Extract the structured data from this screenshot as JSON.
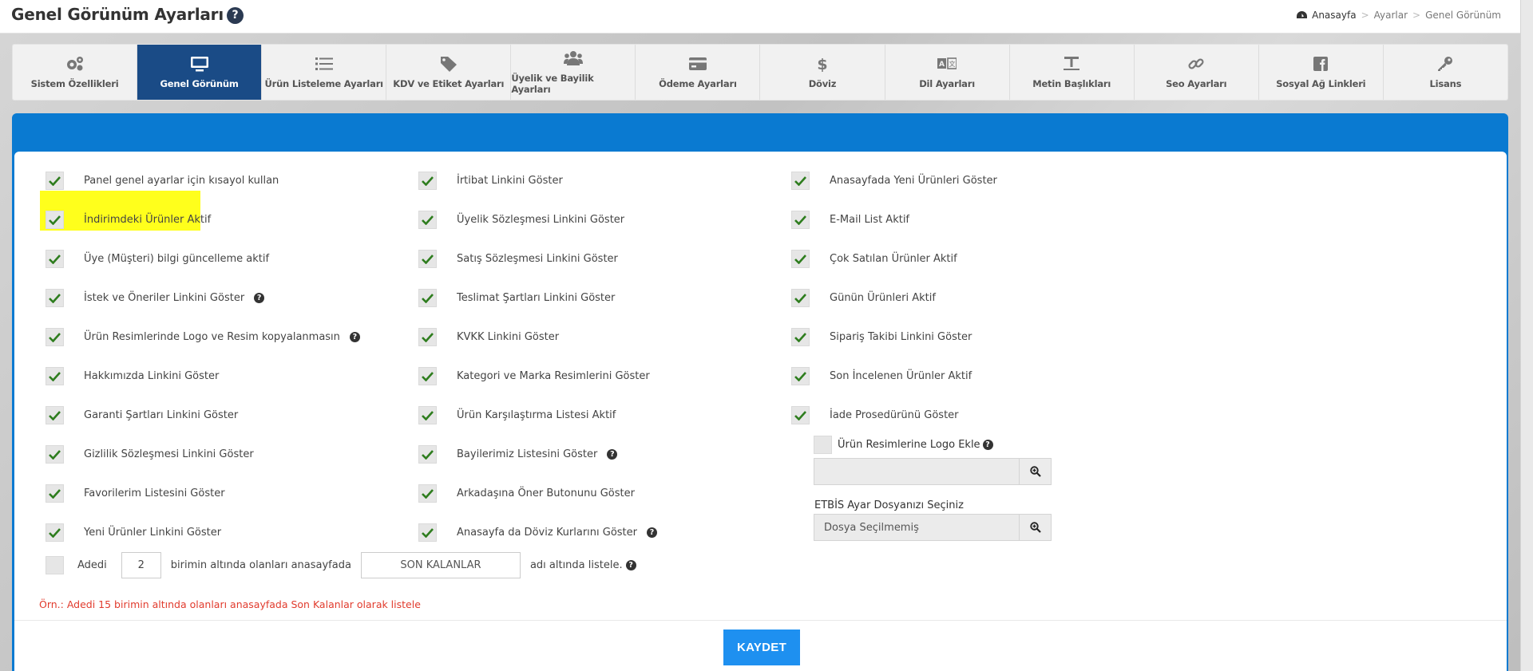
{
  "header": {
    "title": "Genel Görünüm Ayarları",
    "help_glyph": "?",
    "breadcrumb": [
      "Anasayfa",
      "Ayarlar",
      "Genel Görünüm"
    ],
    "breadcrumb_sep": ">"
  },
  "tabs": [
    {
      "label": "Sistem Özellikleri",
      "icon": "gears-icon",
      "active": false
    },
    {
      "label": "Genel Görünüm",
      "icon": "monitor-icon",
      "active": true
    },
    {
      "label": "Ürün Listeleme Ayarları",
      "icon": "list-icon",
      "active": false
    },
    {
      "label": "KDV ve Etiket Ayarları",
      "icon": "tags-icon",
      "active": false
    },
    {
      "label": "Üyelik ve Bayilik Ayarları",
      "icon": "users-icon",
      "active": false
    },
    {
      "label": "Ödeme Ayarları",
      "icon": "credit-card-icon",
      "active": false
    },
    {
      "label": "Döviz",
      "icon": "dollar-icon",
      "active": false
    },
    {
      "label": "Dil Ayarları",
      "icon": "language-icon",
      "active": false
    },
    {
      "label": "Metin Başlıkları",
      "icon": "text-heading-icon",
      "active": false
    },
    {
      "label": "Seo Ayarları",
      "icon": "link-icon",
      "active": false
    },
    {
      "label": "Sosyal Ağ Linkleri",
      "icon": "facebook-icon",
      "active": false
    },
    {
      "label": "Lisans",
      "icon": "key-icon",
      "active": false
    }
  ],
  "columns": {
    "col1": [
      {
        "label": "Panel genel ayarlar için kısayol kullan",
        "checked": true
      },
      {
        "label": "İndirimdeki Ürünler Aktif",
        "checked": true,
        "highlighted": true
      },
      {
        "label": "Üye (Müşteri) bilgi güncelleme aktif",
        "checked": true
      },
      {
        "label": "İstek ve Öneriler Linkini Göster",
        "checked": true,
        "help": true
      },
      {
        "label": "Ürün Resimlerinde Logo ve Resim kopyalanmasın",
        "checked": true,
        "help": true
      },
      {
        "label": "Hakkımızda Linkini Göster",
        "checked": true
      },
      {
        "label": "Garanti Şartları Linkini Göster",
        "checked": true
      },
      {
        "label": "Gizlilik Sözleşmesi Linkini Göster",
        "checked": true
      },
      {
        "label": "Favorilerim Listesini Göster",
        "checked": true
      },
      {
        "label": "Yeni Ürünler Linkini Göster",
        "checked": true
      }
    ],
    "col2": [
      {
        "label": "İrtibat Linkini Göster",
        "checked": true
      },
      {
        "label": "Üyelik Sözleşmesi Linkini Göster",
        "checked": true
      },
      {
        "label": "Satış Sözleşmesi Linkini Göster",
        "checked": true
      },
      {
        "label": "Teslimat Şartları Linkini Göster",
        "checked": true
      },
      {
        "label": "KVKK Linkini Göster",
        "checked": true
      },
      {
        "label": "Kategori ve Marka Resimlerini Göster",
        "checked": true
      },
      {
        "label": "Ürün Karşılaştırma Listesi Aktif",
        "checked": true
      },
      {
        "label": "Bayilerimiz Listesini Göster",
        "checked": true,
        "help": true
      },
      {
        "label": "Arkadaşına Öner Butonunu Göster",
        "checked": true
      },
      {
        "label": "Anasayfa da Döviz Kurlarını Göster",
        "checked": true,
        "help": true
      }
    ],
    "col3": [
      {
        "label": "Anasayfada Yeni Ürünleri Göster",
        "checked": true
      },
      {
        "label": "E-Mail List Aktif",
        "checked": true
      },
      {
        "label": "Çok Satılan Ürünler Aktif",
        "checked": true
      },
      {
        "label": "Günün Ürünleri Aktif",
        "checked": true
      },
      {
        "label": "Sipariş Takibi Linkini Göster",
        "checked": true
      },
      {
        "label": "Son İncelenen Ürünler Aktif",
        "checked": true
      },
      {
        "label": "İade Prosedürünü Göster",
        "checked": true
      }
    ]
  },
  "logo_option": {
    "label": "Ürün Resimlerine Logo Ekle",
    "checked": false,
    "file_value": ""
  },
  "etbis": {
    "label": "ETBİS Ayar Dosyanızı Seçiniz",
    "file_value": "Dosya Seçilmemiş"
  },
  "stock_rule": {
    "checked": false,
    "prefix": "Adedi",
    "quantity": "2",
    "middle": "birimin altında olanları anasayfada",
    "section_name": "SON KALANLAR",
    "suffix": "adı altında listele."
  },
  "example_note": "Örn.: Adedi 15 birimin altında olanları anasayfada Son Kalanlar olarak listele",
  "save_label": "KAYDET",
  "colors": {
    "accent": "#0a7ad1",
    "active_tab": "#1a4b86",
    "check": "#2e7d1e",
    "highlight": "#ffff1c",
    "note": "#e13b2d",
    "save": "#1e90f0"
  }
}
